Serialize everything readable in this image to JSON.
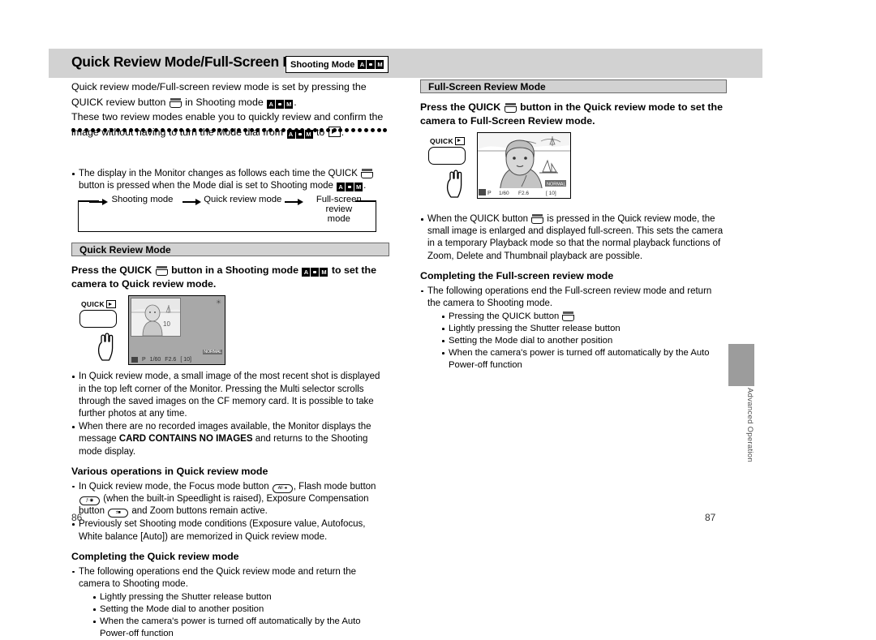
{
  "header": {
    "title_part1": "Quick Review Mode",
    "slash": "/",
    "title_part2": "Full-Screen Review Mode",
    "badge_label": "Shooting Mode",
    "badge_icons": [
      "A",
      "camera",
      "M"
    ]
  },
  "intro": {
    "line1": "Quick review mode/Full-screen review mode is set by pressing the",
    "line2a": "QUICK review button",
    "line2b": "in Shooting mode",
    "line2c": ".",
    "line3": "These two review modes enable you to quickly review and confirm the",
    "line4a": "image without having to turn the Mode dial from",
    "line4b": "to",
    "line4c": "."
  },
  "bullet_display": {
    "a": "The display in the Monitor changes as follows each time the QUICK",
    "b": "button is",
    "c": "pressed when the Mode dial is set to Shooting mode",
    "d": "."
  },
  "flow": {
    "step1": "Shooting mode",
    "step2": "Quick review mode",
    "step3_line1": "Full-screen review",
    "step3_line2": "mode"
  },
  "quick_section": {
    "bar_title": "Quick Review Mode",
    "lead_a": "Press the QUICK",
    "lead_b": "button in a Shooting mode",
    "lead_c": "to set the",
    "lead_d": "camera to Quick review mode.",
    "illustration": {
      "button_label": "QUICK",
      "button_icon": "play-icon",
      "monitor_status": [
        "P",
        "1/60",
        "F2.6",
        "[ 10]"
      ],
      "quality_tag": "NORMAL",
      "frame_number": "10"
    },
    "bullets": [
      "In Quick review mode, a small image of the most recent shot is displayed in the top left corner of the Monitor. Pressing the Multi selector scrolls through the saved images on the CF memory card. It is possible to take further photos at any time.",
      "When there are no recorded images available, the Monitor displays the message"
    ],
    "bullet2_bold": "CARD CONTAINS NO IMAGES",
    "bullet2_tail": "and returns to the Shooting mode display.",
    "various_head": "Various operations in Quick review mode",
    "various_b1_a": "In Quick review mode, the Focus mode button",
    "various_b1_icon1": "AF·●",
    "various_b1_b": ", Flash mode button",
    "various_b1_icon2": "ƒ·◉",
    "various_b1_c": "(when the built-in Speedlight is raised), Exposure Compensation button",
    "various_b1_icon3": "±■",
    "various_b1_d": "and",
    "various_b1_e": "Zoom buttons remain active.",
    "various_b2": "Previously set Shooting mode conditions (Exposure value, Autofocus, White balance [Auto]) are memorized in Quick review mode.",
    "completing_head": "Completing the Quick review mode",
    "completing_b1": "The following operations end the Quick review mode and return the camera to Shooting mode.",
    "completing_sub": [
      "Lightly pressing the Shutter release button",
      "Setting the Mode dial to another position",
      "When the camera's power is turned off automatically by the Auto Power-off function"
    ]
  },
  "full_section": {
    "bar_title": "Full-Screen Review Mode",
    "lead_a": "Press the QUICK",
    "lead_b": "button in the Quick review mode to set the",
    "lead_c": "camera to Full-Screen Review mode.",
    "illustration": {
      "button_label": "QUICK",
      "button_icon": "play-icon",
      "monitor_status": [
        "P",
        "1/60",
        "F2.6",
        "[ 10]"
      ],
      "quality_tag": "NORMAL"
    },
    "bullet1_a": "When the QUICK button",
    "bullet1_b": "is pressed in the Quick review mode, the small image is enlarged and displayed full-screen. This sets the camera in a temporary Playback mode so that the normal playback functions of Zoom, Delete and Thumbnail playback are possible.",
    "completing_head": "Completing the Full-screen review mode",
    "completing_b1": "The following operations end the Full-screen review mode and return the camera to Shooting mode.",
    "completing_sub_1": "Pressing the QUICK button",
    "completing_sub": [
      "Lightly pressing the Shutter release button",
      "Setting the Mode dial to another position",
      "When the camera's power is turned off automatically by the Auto Power-off function"
    ]
  },
  "side_tab": {
    "label": "Advanced Operation"
  },
  "page_numbers": {
    "left": "86",
    "right": "87"
  },
  "colors": {
    "header_bg": "#d2d2d2",
    "section_bar_bg": "#d2d2d2",
    "monitor_bg": "#a8a8a8",
    "side_tab": "#9c9c9c"
  }
}
